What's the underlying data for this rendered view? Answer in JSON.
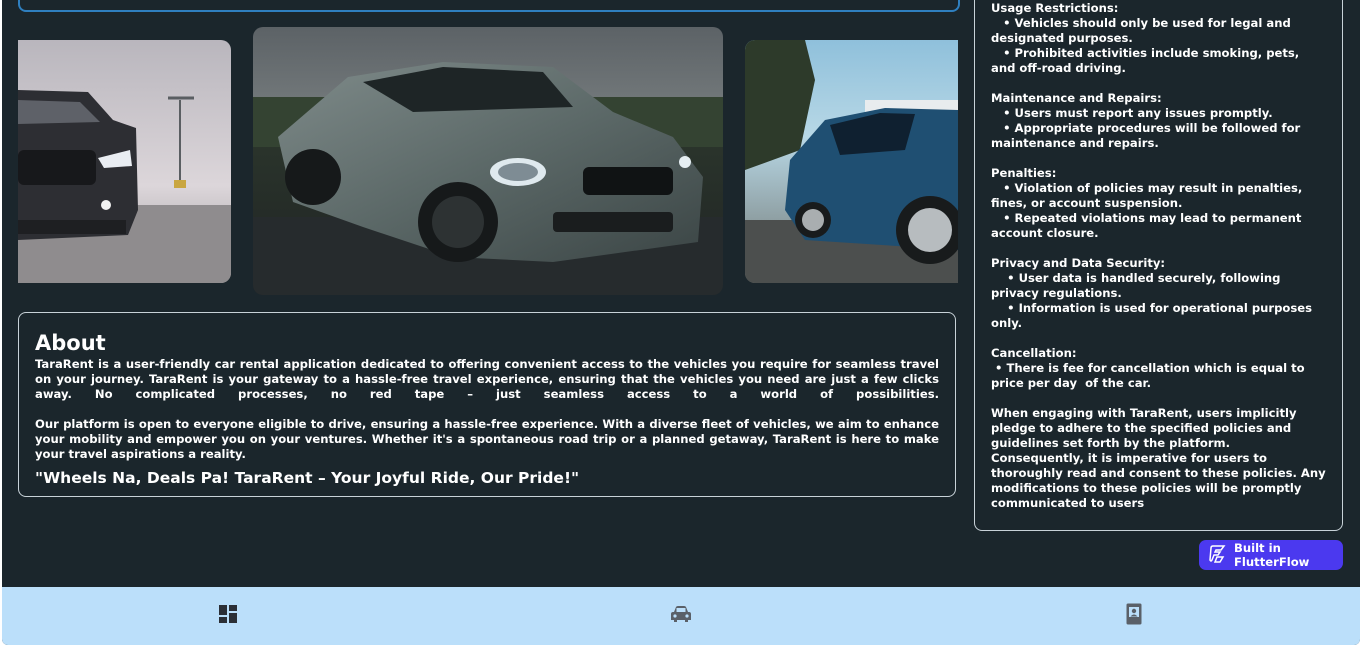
{
  "about": {
    "title": "About",
    "paragraph1": "TaraRent is a user-friendly car rental application dedicated to offering convenient access to the vehicles you require for seamless travel on your journey. TaraRent  is your gateway to a hassle-free travel experience, ensuring that the vehicles you need are just a few clicks away. No complicated processes, no red tape – just seamless access to a world of possibilities.",
    "paragraph2": "Our platform is open to everyone eligible to drive, ensuring a hassle-free experience. With a diverse fleet of vehicles, we aim to enhance your mobility and empower you on your ventures. Whether it's a spontaneous road trip or a planned getaway, TaraRent is here to make your travel aspirations a reality.",
    "tagline": "\"Wheels Na, Deals Pa! TaraRent – Your Joyful Ride, Our Pride!\""
  },
  "policies": {
    "lines": [
      "Usage Restrictions:",
      "   • Vehicles should only be used for legal and designated purposes.",
      "   • Prohibited activities include smoking, pets, and off-road driving.",
      "",
      "Maintenance and Repairs:",
      "   • Users must report any issues promptly.",
      "   • Appropriate procedures will be followed for maintenance and repairs.",
      "",
      "Penalties:",
      "   • Violation of policies may result in penalties, fines, or account suspension.",
      "   • Repeated violations may lead to permanent account closure.",
      "",
      "Privacy and Data Security:",
      "    • User data is handled securely, following privacy regulations.",
      "    • Information is used for operational purposes only.",
      "",
      "Cancellation:",
      " • There is fee for cancellation which is equal to price per day  of the car.",
      "",
      "When engaging with TaraRent, users implicitly pledge to adhere to the specified policies and guidelines set forth by the platform. Consequently, it is imperative for users to thoroughly read and consent to these policies. Any modifications to these policies will be promptly communicated to users"
    ]
  },
  "badge": {
    "label": "Built in FlutterFlow"
  },
  "nav": {
    "items": [
      "dashboard-icon",
      "car-icon",
      "contact-card-icon"
    ]
  },
  "colors": {
    "background": "#1b262c",
    "nav_background": "#bbdffa",
    "badge": "#4b39ef",
    "accent_strip": "#2f7fbf"
  }
}
